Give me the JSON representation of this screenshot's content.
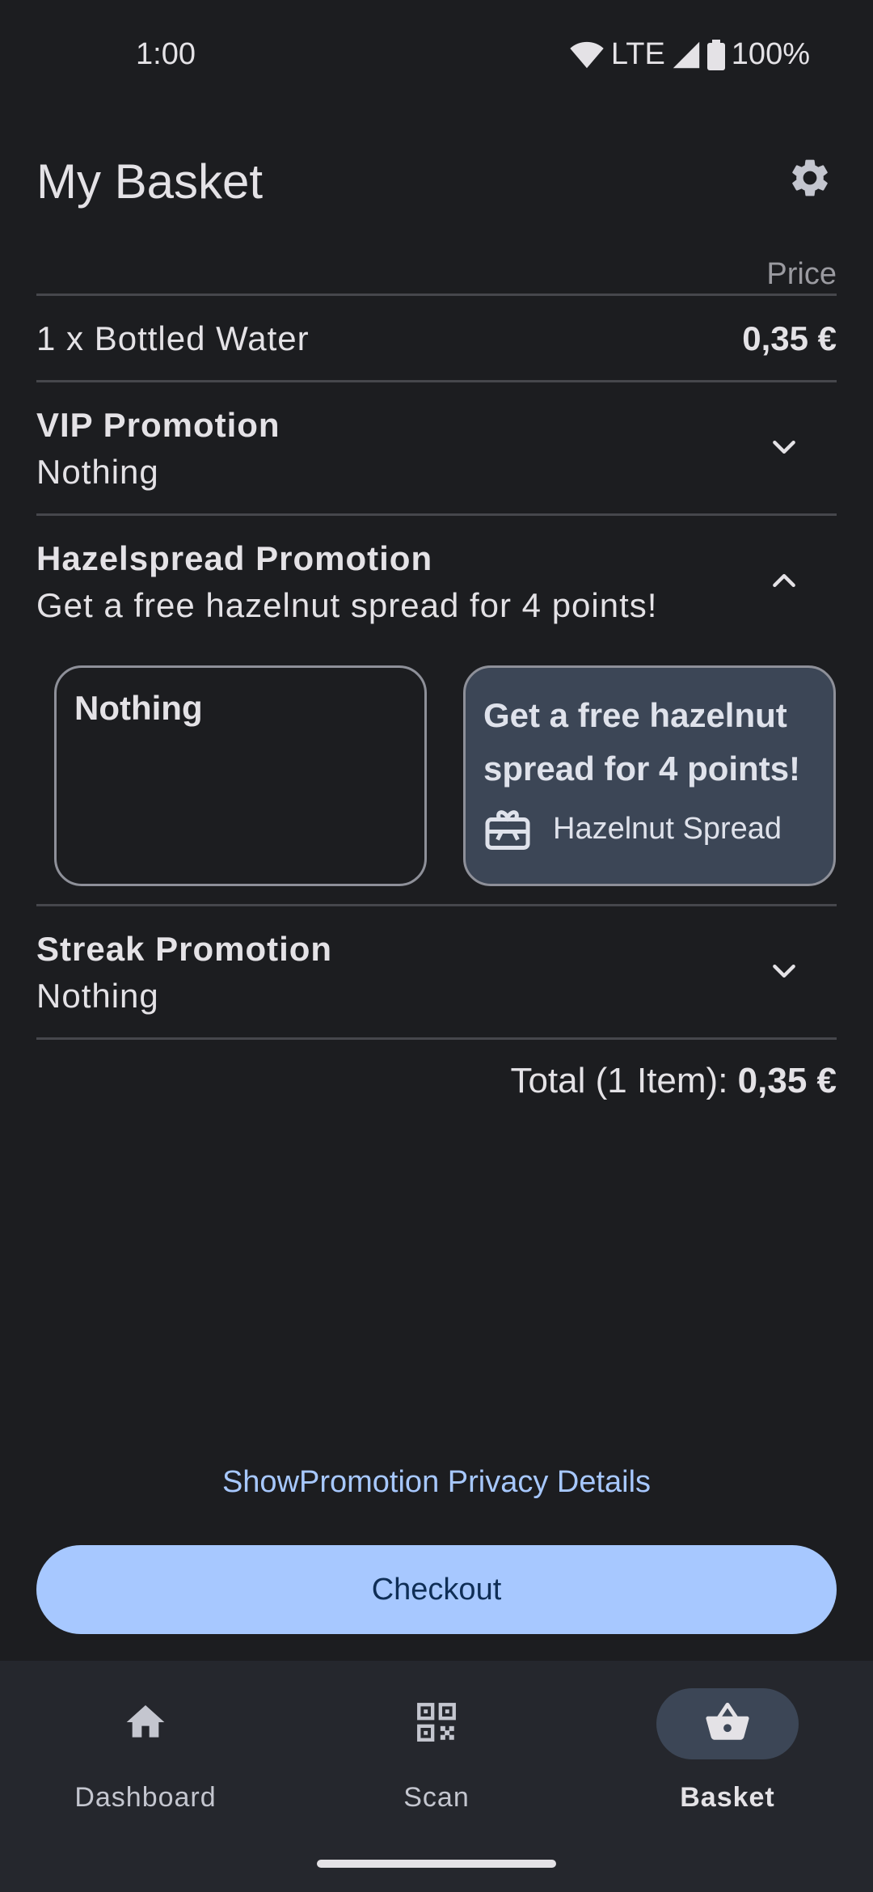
{
  "status_bar": {
    "time": "1:00",
    "network": "LTE",
    "battery": "100%"
  },
  "header": {
    "title": "My Basket"
  },
  "table": {
    "price_header": "Price",
    "items": [
      {
        "label": "1 x Bottled Water",
        "price": "0,35 €"
      }
    ]
  },
  "promotions": [
    {
      "title": "VIP Promotion",
      "selection": "Nothing",
      "expanded": false
    },
    {
      "title": "Hazelspread Promotion",
      "selection": "Get a free hazelnut spread for 4 points!",
      "expanded": true,
      "options": [
        {
          "title": "Nothing",
          "selected": false
        },
        {
          "title": "Get a free hazelnut spread for 4 points!",
          "selected": true,
          "reward": "Hazelnut Spread"
        }
      ]
    },
    {
      "title": "Streak Promotion",
      "selection": "Nothing",
      "expanded": false
    }
  ],
  "total": {
    "label": "Total (1 Item):",
    "value": "0,35 €"
  },
  "privacy_link": "ShowPromotion Privacy Details",
  "checkout_label": "Checkout",
  "bottom_nav": {
    "items": [
      {
        "label": "Dashboard",
        "icon": "home-icon",
        "active": false
      },
      {
        "label": "Scan",
        "icon": "qr-code-icon",
        "active": false
      },
      {
        "label": "Basket",
        "icon": "basket-icon",
        "active": true
      }
    ]
  },
  "colors": {
    "background": "#1c1d20",
    "accent": "#a7c8ff",
    "selected_card": "#3c4656",
    "nav_background": "#25272d"
  }
}
